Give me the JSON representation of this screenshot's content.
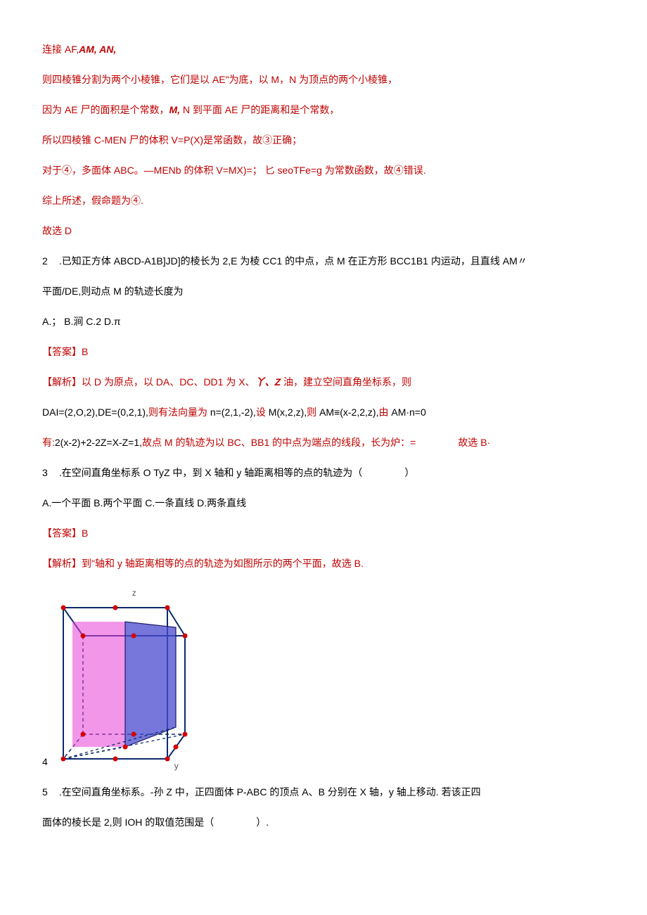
{
  "p1": "连接 AF,",
  "p1b": "AM, AN,",
  "p2": "则四棱锥分割为两个小棱锥，它们是以 AE\"为底，以 M，N 为顶点的两个小棱锥，",
  "p3a": "因为 AE 尸的面积是个常数，",
  "p3b": "M,",
  "p3c": " N 到平面 AE 尸的距离和是个常数，",
  "p4": "所以四棱锥 C-MEN 尸的体积 V=P(X)是常函数，故③正确；",
  "p5": "对于④，多面体 ABC。—MENb 的体积 V=MX)=； 匕 seoTFe=g 为常数函数，故④错误.",
  "p6": "综上所述，假命题为④.",
  "p7": "故选 D",
  "q2num": "2",
  "q2a": " .已知正方体 ABCD-A1B]JD]的棱长为 2,E 为棱 CC1 的中点，点 M 在正方形 BCC1B1 内运动，且直线 AM〃",
  "q2b": "平面/DE,则动点 M 的轨迹长度为",
  "q2opt": "A.； B.涧 C.2  D.π",
  "ans2": "【答案】B",
  "exp2a": "【解析】以 D 为原点，以 DA、DC、DD1 为 X、",
  "exp2b": "丫、Z",
  "exp2c": " 油，建立空间直角坐标系，则",
  "exp2d": "DAI=(2,O,2),DE=(0,2,1),",
  "exp2e": "则有法向量为 ",
  "exp2f": "n=(2,1,-2),",
  "exp2g": "设 ",
  "exp2h": "M(x,2,z),",
  "exp2i": "则 ",
  "exp2j": "AM≡(x-2,2,z),",
  "exp2k": "由 ",
  "exp2l": "AM·n=0",
  "exp2m": "有:",
  "exp2n": "2(x-2)+2-2Z=X-Z=1,",
  "exp2o": "故点 M 的轨迹为以 BC、BB1 的中点为端点的线段，长为炉：=",
  "exp2p": "故选 B·",
  "q3num": "3",
  "q3a": " .在空间直角坐标系 O TyZ 中，到 X 轴和 y 轴距离相等的点的轨迹为（",
  "q3b": "）",
  "q3opt": "A.一个平面 B.两个平面 C.一条直线 D.两条直线",
  "ans3": "【答案】B",
  "exp3": "【解析】到\"轴和 y 轴距离相等的点的轨迹为如图所示的两个平面，故选 B.",
  "fig4": "4",
  "figz": "z",
  "figy": "y",
  "q5num": "5",
  "q5a": " .在空间直角坐标系。-孙 Z 中，正四面体 P-ABC 的顶点 A、B 分别在 X 轴，y 轴上移动. 若该正四",
  "q5b": "面体的棱长是 2,则 IOH 的取值范围是（",
  "q5c": "）."
}
